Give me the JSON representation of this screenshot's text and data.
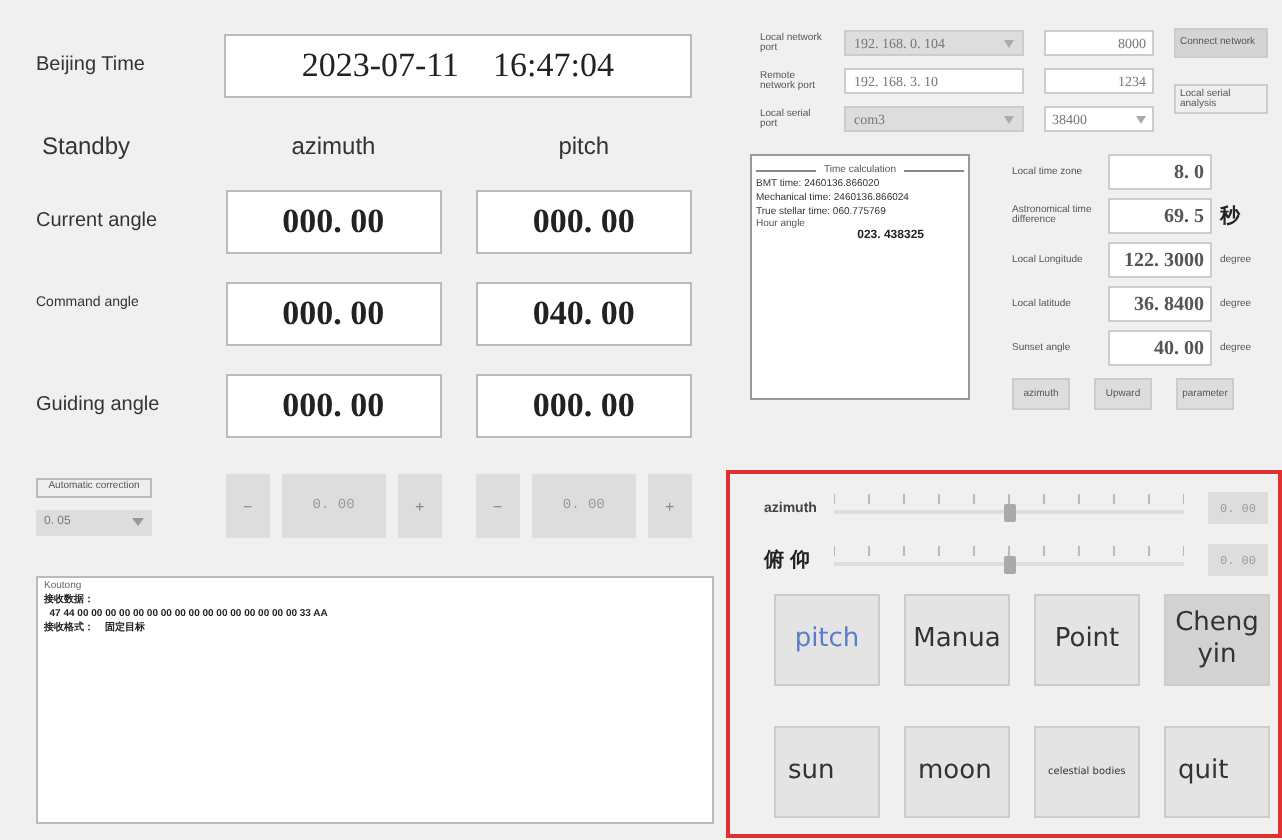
{
  "beijing_time": {
    "label": "Beijing Time",
    "value": "2023-07-11    16:47:04"
  },
  "headings": {
    "mode": "Standby",
    "azimuth": "azimuth",
    "pitch": "pitch"
  },
  "angle_rows": [
    {
      "label": "Current angle",
      "azimuth": "000. 00",
      "pitch": "000. 00",
      "small": false
    },
    {
      "label": "Command angle",
      "azimuth": "000. 00",
      "pitch": "040. 00",
      "small": true
    },
    {
      "label": "Guiding angle",
      "azimuth": "000. 00",
      "pitch": "000. 00",
      "small": false
    }
  ],
  "correction": {
    "button": "Automatic correction",
    "step": "0. 05",
    "steppers": [
      {
        "minus": "−",
        "value": "0. 00",
        "plus": "+"
      },
      {
        "minus": "−",
        "value": "0. 00",
        "plus": "+"
      }
    ]
  },
  "log": {
    "title": "Koutong",
    "lines": [
      "接收数据：",
      "  47 44 00 00 00 00 00 00 00 00 00 00 00 00 00 00 00 00 33 AA",
      "接收格式：    固定目标"
    ]
  },
  "network": [
    {
      "label": "Local network port",
      "address": "192. 168. 0. 104",
      "dropdown": true,
      "port": "8000",
      "port_dropdown": false
    },
    {
      "label": "Remote network port",
      "address": "192. 168. 3. 10",
      "dropdown": false,
      "port": "1234",
      "port_dropdown": false
    },
    {
      "label": "Local serial port",
      "address": "com3",
      "dropdown": true,
      "port": "38400",
      "port_dropdown": true
    }
  ],
  "network_buttons": [
    {
      "label": "Connect network",
      "pressed": true
    },
    {
      "label": "Local serial analysis",
      "pressed": false
    }
  ],
  "time_panel": {
    "title": "Time calculation",
    "lines": [
      "BMT time: 2460136.866020",
      "Mechanical time: 2460136.866024",
      "True stellar time: 060.775769"
    ],
    "angle_label": "Hour angle",
    "angle_value": "023. 438325"
  },
  "params": [
    {
      "label": "Local time zone",
      "value": "8. 0"
    },
    {
      "label": "Astronomical time difference",
      "value": "69. 5",
      "unit": "秒"
    },
    {
      "label": "Local Longitude",
      "value": "122. 3000",
      "unit": "degree"
    },
    {
      "label": "Local latitude",
      "value": "36. 8400",
      "unit": "degree"
    },
    {
      "label": "Sunset angle",
      "value": "40. 00",
      "unit": "degree"
    }
  ],
  "param_buttons": [
    "azimuth",
    "Upward",
    "parameter"
  ],
  "sliders": [
    {
      "label": "azimuth",
      "level": 0.5,
      "reading": "0. 00"
    },
    {
      "label": "俯 仰",
      "level": 0.5,
      "reading": "0. 00"
    }
  ],
  "mode_buttons": [
    {
      "label": "pitch",
      "highlighted": true,
      "pressed": false,
      "kind": "big"
    },
    {
      "label": "Manua",
      "highlighted": false,
      "pressed": false,
      "kind": "big"
    },
    {
      "label": "Point",
      "highlighted": false,
      "pressed": false,
      "kind": "big"
    },
    {
      "label": "Cheng yin",
      "highlighted": false,
      "pressed": true,
      "kind": "big"
    },
    {
      "label": "sun",
      "highlighted": false,
      "pressed": false,
      "kind": "big"
    },
    {
      "label": "moon",
      "highlighted": false,
      "pressed": false,
      "kind": "big"
    },
    {
      "label": "celestial bodies",
      "highlighted": false,
      "pressed": false,
      "kind": "small"
    },
    {
      "label": "quit",
      "highlighted": false,
      "pressed": false,
      "kind": "big"
    }
  ]
}
